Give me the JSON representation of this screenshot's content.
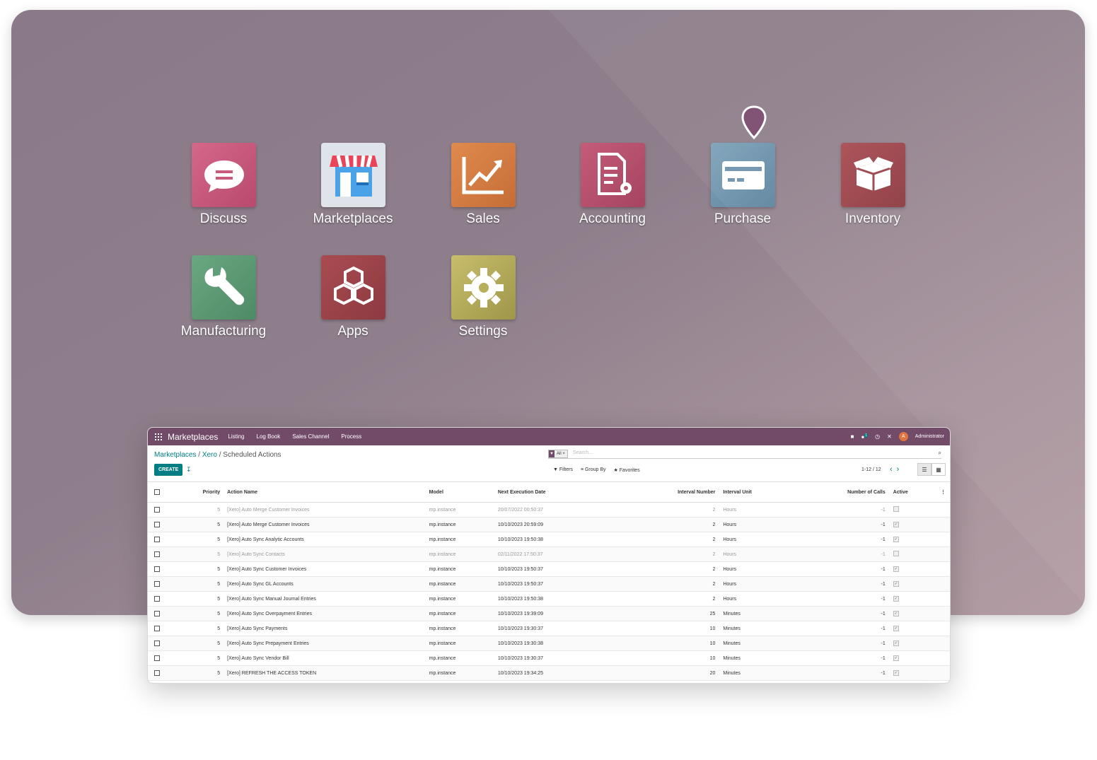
{
  "apps": [
    {
      "label": "Discuss",
      "icon": "chat-bubble-icon",
      "color": "#c95a7b"
    },
    {
      "label": "Marketplaces",
      "icon": "storefront-icon",
      "color": "#dfe3ea"
    },
    {
      "label": "Sales",
      "icon": "trend-chart-icon",
      "color": "#d37d44"
    },
    {
      "label": "Accounting",
      "icon": "document-gear-icon",
      "color": "#b5526e"
    },
    {
      "label": "Purchase",
      "icon": "credit-card-icon",
      "color": "#6f94ad"
    },
    {
      "label": "Inventory",
      "icon": "open-box-icon",
      "color": "#9c4349"
    },
    {
      "label": "Manufacturing",
      "icon": "wrench-icon",
      "color": "#5c9a74"
    },
    {
      "label": "Apps",
      "icon": "cubes-icon",
      "color": "#9c4349"
    },
    {
      "label": "Settings",
      "icon": "gear-icon",
      "color": "#b8ae5c"
    }
  ],
  "window": {
    "brand": "Marketplaces",
    "menu": [
      "Listing",
      "Log Book",
      "Sales Channel",
      "Process"
    ],
    "chat_count": "1",
    "user_initial": "A",
    "user": "Administrator",
    "breadcrumb": {
      "first": "Marketplaces",
      "second": "Xero",
      "current": "Scheduled Actions"
    },
    "search": {
      "facet_label": "All",
      "placeholder": "Search..."
    },
    "create_label": "CREATE",
    "filters": "Filters",
    "group_by": "Group By",
    "favorites": "Favorites",
    "pager": "1-12 / 12",
    "columns": {
      "priority": "Priority",
      "name": "Action Name",
      "model": "Model",
      "next": "Next Execution Date",
      "interval_number": "Interval Number",
      "interval_unit": "Interval Unit",
      "calls": "Number of Calls",
      "active": "Active"
    },
    "rows": [
      {
        "priority": "5",
        "name": "[Xero] Auto Merge Customer Invoices",
        "model": "mp.instance",
        "next": "20/07/2022 00:50:37",
        "interval_number": "2",
        "interval_unit": "Hours",
        "calls": "-1",
        "active": false
      },
      {
        "priority": "5",
        "name": "[Xero] Auto Merge Customer Invoices",
        "model": "mp.instance",
        "next": "10/10/2023 20:59:09",
        "interval_number": "2",
        "interval_unit": "Hours",
        "calls": "-1",
        "active": true
      },
      {
        "priority": "5",
        "name": "[Xero] Auto Sync Analytic Accounts",
        "model": "mp.instance",
        "next": "10/10/2023 19:50:38",
        "interval_number": "2",
        "interval_unit": "Hours",
        "calls": "-1",
        "active": true
      },
      {
        "priority": "5",
        "name": "[Xero] Auto Sync Contacts",
        "model": "mp.instance",
        "next": "02/11/2022 17:50:37",
        "interval_number": "2",
        "interval_unit": "Hours",
        "calls": "-1",
        "active": false
      },
      {
        "priority": "5",
        "name": "[Xero] Auto Sync Customer Invoices",
        "model": "mp.instance",
        "next": "10/10/2023 19:50:37",
        "interval_number": "2",
        "interval_unit": "Hours",
        "calls": "-1",
        "active": true
      },
      {
        "priority": "5",
        "name": "[Xero] Auto Sync GL Accounts",
        "model": "mp.instance",
        "next": "10/10/2023 19:50:37",
        "interval_number": "2",
        "interval_unit": "Hours",
        "calls": "-1",
        "active": true
      },
      {
        "priority": "5",
        "name": "[Xero] Auto Sync Manual Journal Entries",
        "model": "mp.instance",
        "next": "10/10/2023 19:50:38",
        "interval_number": "2",
        "interval_unit": "Hours",
        "calls": "-1",
        "active": true
      },
      {
        "priority": "5",
        "name": "[Xero] Auto Sync Overpayment Entries",
        "model": "mp.instance",
        "next": "10/10/2023 19:39:09",
        "interval_number": "25",
        "interval_unit": "Minutes",
        "calls": "-1",
        "active": true
      },
      {
        "priority": "5",
        "name": "[Xero] Auto Sync Payments",
        "model": "mp.instance",
        "next": "10/10/2023 19:30:37",
        "interval_number": "10",
        "interval_unit": "Minutes",
        "calls": "-1",
        "active": true
      },
      {
        "priority": "5",
        "name": "[Xero] Auto Sync Prepayment Entries",
        "model": "mp.instance",
        "next": "10/10/2023 19:30:38",
        "interval_number": "10",
        "interval_unit": "Minutes",
        "calls": "-1",
        "active": true
      },
      {
        "priority": "5",
        "name": "[Xero] Auto Sync Vendor Bill",
        "model": "mp.instance",
        "next": "10/10/2023 19:30:37",
        "interval_number": "10",
        "interval_unit": "Minutes",
        "calls": "-1",
        "active": true
      },
      {
        "priority": "5",
        "name": "[Xero] REFRESH THE ACCESS TOKEN",
        "model": "mp.instance",
        "next": "10/10/2023 19:34:25",
        "interval_number": "20",
        "interval_unit": "Minutes",
        "calls": "-1",
        "active": true
      }
    ]
  }
}
